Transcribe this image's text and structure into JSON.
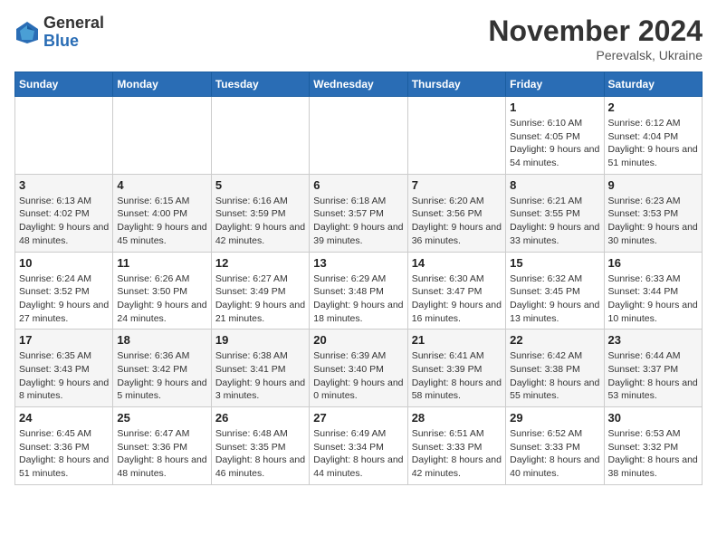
{
  "logo": {
    "text_general": "General",
    "text_blue": "Blue"
  },
  "header": {
    "month": "November 2024",
    "location": "Perevalsk, Ukraine"
  },
  "weekdays": [
    "Sunday",
    "Monday",
    "Tuesday",
    "Wednesday",
    "Thursday",
    "Friday",
    "Saturday"
  ],
  "weeks": [
    [
      {
        "day": "",
        "sunrise": "",
        "sunset": "",
        "daylight": ""
      },
      {
        "day": "",
        "sunrise": "",
        "sunset": "",
        "daylight": ""
      },
      {
        "day": "",
        "sunrise": "",
        "sunset": "",
        "daylight": ""
      },
      {
        "day": "",
        "sunrise": "",
        "sunset": "",
        "daylight": ""
      },
      {
        "day": "",
        "sunrise": "",
        "sunset": "",
        "daylight": ""
      },
      {
        "day": "1",
        "sunrise": "Sunrise: 6:10 AM",
        "sunset": "Sunset: 4:05 PM",
        "daylight": "Daylight: 9 hours and 54 minutes."
      },
      {
        "day": "2",
        "sunrise": "Sunrise: 6:12 AM",
        "sunset": "Sunset: 4:04 PM",
        "daylight": "Daylight: 9 hours and 51 minutes."
      }
    ],
    [
      {
        "day": "3",
        "sunrise": "Sunrise: 6:13 AM",
        "sunset": "Sunset: 4:02 PM",
        "daylight": "Daylight: 9 hours and 48 minutes."
      },
      {
        "day": "4",
        "sunrise": "Sunrise: 6:15 AM",
        "sunset": "Sunset: 4:00 PM",
        "daylight": "Daylight: 9 hours and 45 minutes."
      },
      {
        "day": "5",
        "sunrise": "Sunrise: 6:16 AM",
        "sunset": "Sunset: 3:59 PM",
        "daylight": "Daylight: 9 hours and 42 minutes."
      },
      {
        "day": "6",
        "sunrise": "Sunrise: 6:18 AM",
        "sunset": "Sunset: 3:57 PM",
        "daylight": "Daylight: 9 hours and 39 minutes."
      },
      {
        "day": "7",
        "sunrise": "Sunrise: 6:20 AM",
        "sunset": "Sunset: 3:56 PM",
        "daylight": "Daylight: 9 hours and 36 minutes."
      },
      {
        "day": "8",
        "sunrise": "Sunrise: 6:21 AM",
        "sunset": "Sunset: 3:55 PM",
        "daylight": "Daylight: 9 hours and 33 minutes."
      },
      {
        "day": "9",
        "sunrise": "Sunrise: 6:23 AM",
        "sunset": "Sunset: 3:53 PM",
        "daylight": "Daylight: 9 hours and 30 minutes."
      }
    ],
    [
      {
        "day": "10",
        "sunrise": "Sunrise: 6:24 AM",
        "sunset": "Sunset: 3:52 PM",
        "daylight": "Daylight: 9 hours and 27 minutes."
      },
      {
        "day": "11",
        "sunrise": "Sunrise: 6:26 AM",
        "sunset": "Sunset: 3:50 PM",
        "daylight": "Daylight: 9 hours and 24 minutes."
      },
      {
        "day": "12",
        "sunrise": "Sunrise: 6:27 AM",
        "sunset": "Sunset: 3:49 PM",
        "daylight": "Daylight: 9 hours and 21 minutes."
      },
      {
        "day": "13",
        "sunrise": "Sunrise: 6:29 AM",
        "sunset": "Sunset: 3:48 PM",
        "daylight": "Daylight: 9 hours and 18 minutes."
      },
      {
        "day": "14",
        "sunrise": "Sunrise: 6:30 AM",
        "sunset": "Sunset: 3:47 PM",
        "daylight": "Daylight: 9 hours and 16 minutes."
      },
      {
        "day": "15",
        "sunrise": "Sunrise: 6:32 AM",
        "sunset": "Sunset: 3:45 PM",
        "daylight": "Daylight: 9 hours and 13 minutes."
      },
      {
        "day": "16",
        "sunrise": "Sunrise: 6:33 AM",
        "sunset": "Sunset: 3:44 PM",
        "daylight": "Daylight: 9 hours and 10 minutes."
      }
    ],
    [
      {
        "day": "17",
        "sunrise": "Sunrise: 6:35 AM",
        "sunset": "Sunset: 3:43 PM",
        "daylight": "Daylight: 9 hours and 8 minutes."
      },
      {
        "day": "18",
        "sunrise": "Sunrise: 6:36 AM",
        "sunset": "Sunset: 3:42 PM",
        "daylight": "Daylight: 9 hours and 5 minutes."
      },
      {
        "day": "19",
        "sunrise": "Sunrise: 6:38 AM",
        "sunset": "Sunset: 3:41 PM",
        "daylight": "Daylight: 9 hours and 3 minutes."
      },
      {
        "day": "20",
        "sunrise": "Sunrise: 6:39 AM",
        "sunset": "Sunset: 3:40 PM",
        "daylight": "Daylight: 9 hours and 0 minutes."
      },
      {
        "day": "21",
        "sunrise": "Sunrise: 6:41 AM",
        "sunset": "Sunset: 3:39 PM",
        "daylight": "Daylight: 8 hours and 58 minutes."
      },
      {
        "day": "22",
        "sunrise": "Sunrise: 6:42 AM",
        "sunset": "Sunset: 3:38 PM",
        "daylight": "Daylight: 8 hours and 55 minutes."
      },
      {
        "day": "23",
        "sunrise": "Sunrise: 6:44 AM",
        "sunset": "Sunset: 3:37 PM",
        "daylight": "Daylight: 8 hours and 53 minutes."
      }
    ],
    [
      {
        "day": "24",
        "sunrise": "Sunrise: 6:45 AM",
        "sunset": "Sunset: 3:36 PM",
        "daylight": "Daylight: 8 hours and 51 minutes."
      },
      {
        "day": "25",
        "sunrise": "Sunrise: 6:47 AM",
        "sunset": "Sunset: 3:36 PM",
        "daylight": "Daylight: 8 hours and 48 minutes."
      },
      {
        "day": "26",
        "sunrise": "Sunrise: 6:48 AM",
        "sunset": "Sunset: 3:35 PM",
        "daylight": "Daylight: 8 hours and 46 minutes."
      },
      {
        "day": "27",
        "sunrise": "Sunrise: 6:49 AM",
        "sunset": "Sunset: 3:34 PM",
        "daylight": "Daylight: 8 hours and 44 minutes."
      },
      {
        "day": "28",
        "sunrise": "Sunrise: 6:51 AM",
        "sunset": "Sunset: 3:33 PM",
        "daylight": "Daylight: 8 hours and 42 minutes."
      },
      {
        "day": "29",
        "sunrise": "Sunrise: 6:52 AM",
        "sunset": "Sunset: 3:33 PM",
        "daylight": "Daylight: 8 hours and 40 minutes."
      },
      {
        "day": "30",
        "sunrise": "Sunrise: 6:53 AM",
        "sunset": "Sunset: 3:32 PM",
        "daylight": "Daylight: 8 hours and 38 minutes."
      }
    ]
  ]
}
